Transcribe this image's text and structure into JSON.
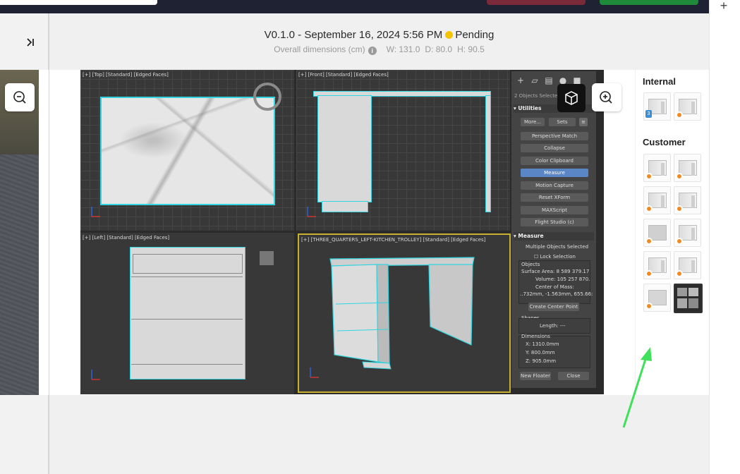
{
  "header": {
    "version": "V0.1.0",
    "separator": "-",
    "datetime": "September 16, 2024 5:56 PM",
    "status": "Pending",
    "status_color": "#f5c400",
    "dims_label": "Overall dimensions (cm)",
    "width": "W: 131.0",
    "depth": "D: 80.0",
    "height": "H: 90.5"
  },
  "viewports": {
    "top": "[+] [Top] [Standard] [Edged Faces]",
    "front": "[+] [Front] [Standard] [Edged Faces]",
    "left": "[+] [Left] [Standard] [Edged Faces]",
    "persp": "[+] [THREE_QUARTERS_LEFT-KITCHEN_TROLLEY] [Standard] [Edged Faces]"
  },
  "utilities": {
    "selection": "2 Objects Selected",
    "section_title": "Utilities",
    "more": "More...",
    "sets": "Sets",
    "buttons": [
      "Perspective Match",
      "Collapse",
      "Color Clipboard",
      "Measure",
      "Motion Capture",
      "Reset XForm",
      "MAXScript",
      "Flight Studio (c)"
    ],
    "measure_title": "Measure",
    "multiple": "Multiple Objects Selected",
    "lock": "Lock Selection",
    "objects": "Objects",
    "surface_area": "Surface Area: 8 589 379.17",
    "volume": "Volume:  105 257 870.",
    "center_mass": "Center of Mass:",
    "center_values": "..732mm, -1.563mm, 655.66:",
    "create_center": "Create Center Point",
    "shapes": "Shapes",
    "length": "Length: ---",
    "dimensions": "Dimensions",
    "dim_x": "X:   1310.0mm",
    "dim_y": "Y:   800.0mm",
    "dim_z": "Z:   905.0mm",
    "new_floater": "New Floater",
    "close": "Close"
  },
  "sidebar": {
    "internal_title": "Internal",
    "customer_title": "Customer",
    "internal_badge": "3"
  },
  "icons": {
    "collapse": "collapse-right-icon",
    "zoom_out": "zoom-out-icon",
    "zoom_in": "zoom-in-icon",
    "cube": "cube-icon",
    "plus": "plus-icon",
    "info": "info-icon"
  }
}
